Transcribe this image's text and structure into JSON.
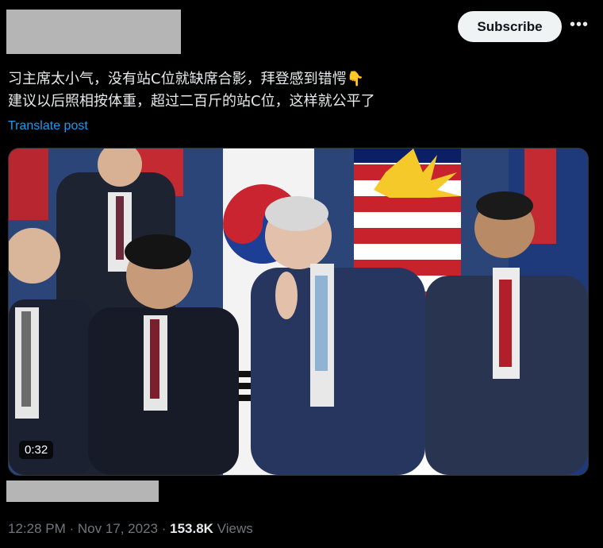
{
  "header": {
    "subscribe_label": "Subscribe",
    "more_icon": "more-horizontal-icon"
  },
  "post": {
    "text_line1": "习主席太小气，没有站C位就缺席合影，拜登感到错愕",
    "emoji": "👇",
    "text_line2": "建议以后照相按体重，超过二百斤的站C位，这样就公平了",
    "translate_label": "Translate post"
  },
  "media": {
    "duration": "0:32"
  },
  "meta": {
    "time": "12:28 PM",
    "separator1": " · ",
    "date": "Nov 17, 2023",
    "separator2": " · ",
    "views_count": "153.8K",
    "views_label": " Views"
  },
  "colors": {
    "background": "#000000",
    "text": "#e7e9ea",
    "link": "#1d9bf0",
    "muted": "#71767b",
    "redaction": "#b5b5b5"
  }
}
